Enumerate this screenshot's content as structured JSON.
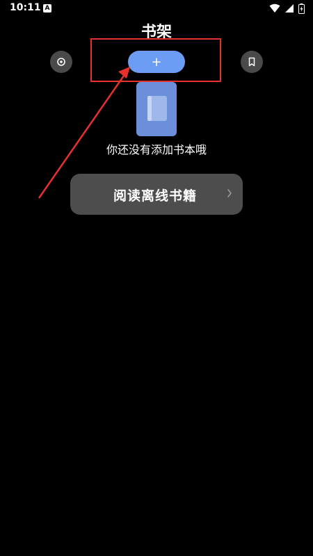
{
  "status_bar": {
    "time": "10:11",
    "app_icon_glyph": "A"
  },
  "header": {
    "title": "书架"
  },
  "toolbar": {
    "left_button_icon": "settings-dot-icon",
    "add_button_label": "+",
    "right_button_icon": "bookmark-icon"
  },
  "empty_state": {
    "icon": "book-icon",
    "message": "你还没有添加书本哦"
  },
  "offline_button": {
    "label": "阅读离线书籍",
    "icon": "chevron-right-icon"
  },
  "colors": {
    "background": "#000000",
    "accent": "#6d9cf5",
    "book_icon": "#6c8fdb",
    "button_bg": "#4d4d4d",
    "annotation": "#e8312f"
  }
}
